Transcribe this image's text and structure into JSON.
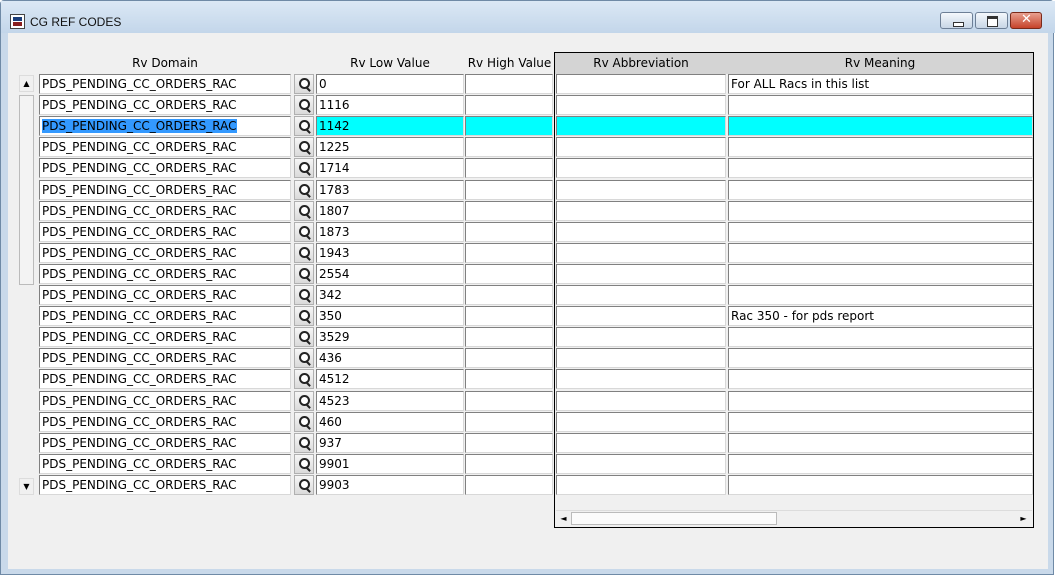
{
  "window": {
    "title": "CG REF CODES",
    "minimize_glyph": "",
    "close_glyph": "✕",
    "icon": "app-form-icon"
  },
  "columns": {
    "domain": "Rv Domain",
    "low": "Rv Low Value",
    "high": "Rv High Value",
    "abbr": "Rv Abbreviation",
    "meaning": "Rv Meaning"
  },
  "scroll": {
    "up": "▲",
    "down": "▼",
    "left": "◄",
    "right": "►"
  },
  "selected_row_index": 2,
  "selection_color": "#00ffff",
  "rows": [
    {
      "domain": "PDS_PENDING_CC_ORDERS_RAC",
      "low": "0",
      "high": "",
      "abbr": "",
      "meaning": "For ALL Racs in this list"
    },
    {
      "domain": "PDS_PENDING_CC_ORDERS_RAC",
      "low": "1116",
      "high": "",
      "abbr": "",
      "meaning": ""
    },
    {
      "domain": "PDS_PENDING_CC_ORDERS_RAC",
      "low": "1142",
      "high": "",
      "abbr": "",
      "meaning": ""
    },
    {
      "domain": "PDS_PENDING_CC_ORDERS_RAC",
      "low": "1225",
      "high": "",
      "abbr": "",
      "meaning": ""
    },
    {
      "domain": "PDS_PENDING_CC_ORDERS_RAC",
      "low": "1714",
      "high": "",
      "abbr": "",
      "meaning": ""
    },
    {
      "domain": "PDS_PENDING_CC_ORDERS_RAC",
      "low": "1783",
      "high": "",
      "abbr": "",
      "meaning": ""
    },
    {
      "domain": "PDS_PENDING_CC_ORDERS_RAC",
      "low": "1807",
      "high": "",
      "abbr": "",
      "meaning": ""
    },
    {
      "domain": "PDS_PENDING_CC_ORDERS_RAC",
      "low": "1873",
      "high": "",
      "abbr": "",
      "meaning": ""
    },
    {
      "domain": "PDS_PENDING_CC_ORDERS_RAC",
      "low": "1943",
      "high": "",
      "abbr": "",
      "meaning": ""
    },
    {
      "domain": "PDS_PENDING_CC_ORDERS_RAC",
      "low": "2554",
      "high": "",
      "abbr": "",
      "meaning": ""
    },
    {
      "domain": "PDS_PENDING_CC_ORDERS_RAC",
      "low": "342",
      "high": "",
      "abbr": "",
      "meaning": ""
    },
    {
      "domain": "PDS_PENDING_CC_ORDERS_RAC",
      "low": "350",
      "high": "",
      "abbr": "",
      "meaning": "Rac 350 - for pds report"
    },
    {
      "domain": "PDS_PENDING_CC_ORDERS_RAC",
      "low": "3529",
      "high": "",
      "abbr": "",
      "meaning": ""
    },
    {
      "domain": "PDS_PENDING_CC_ORDERS_RAC",
      "low": "436",
      "high": "",
      "abbr": "",
      "meaning": ""
    },
    {
      "domain": "PDS_PENDING_CC_ORDERS_RAC",
      "low": "4512",
      "high": "",
      "abbr": "",
      "meaning": ""
    },
    {
      "domain": "PDS_PENDING_CC_ORDERS_RAC",
      "low": "4523",
      "high": "",
      "abbr": "",
      "meaning": ""
    },
    {
      "domain": "PDS_PENDING_CC_ORDERS_RAC",
      "low": "460",
      "high": "",
      "abbr": "",
      "meaning": ""
    },
    {
      "domain": "PDS_PENDING_CC_ORDERS_RAC",
      "low": "937",
      "high": "",
      "abbr": "",
      "meaning": ""
    },
    {
      "domain": "PDS_PENDING_CC_ORDERS_RAC",
      "low": "9901",
      "high": "",
      "abbr": "",
      "meaning": ""
    },
    {
      "domain": "PDS_PENDING_CC_ORDERS_RAC",
      "low": "9903",
      "high": "",
      "abbr": "",
      "meaning": ""
    }
  ]
}
